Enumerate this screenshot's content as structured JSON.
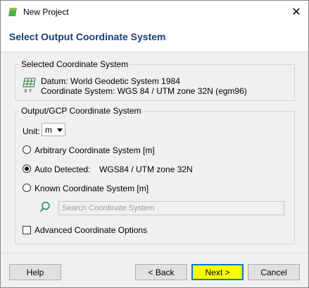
{
  "window": {
    "title": "New Project"
  },
  "header": {
    "title": "Select Output Coordinate System"
  },
  "selected": {
    "group_title": "Selected Coordinate System",
    "datum": "Datum: World Geodetic System 1984",
    "coordinate_system": "Coordinate System: WGS 84 / UTM zone 32N (egm96)",
    "icon": "coordinate-grid-icon",
    "icon_text": "X Y"
  },
  "output": {
    "group_title": "Output/GCP Coordinate System",
    "unit_label": "Unit:",
    "unit_value": "m",
    "options": {
      "arbitrary": "Arbitrary Coordinate System [m]",
      "auto": "Auto Detected:",
      "auto_value": "WGS84 / UTM zone 32N",
      "known": "Known Coordinate System [m]"
    },
    "selected_option": "auto",
    "search_placeholder": "Search Coordinate System",
    "advanced_label": "Advanced Coordinate Options",
    "advanced_checked": false
  },
  "buttons": {
    "help": "Help",
    "back": "< Back",
    "next": "Next >",
    "cancel": "Cancel"
  },
  "colors": {
    "title_blue": "#1a3c7a",
    "highlight_yellow": "#ffff00",
    "focus_blue": "#0078d7",
    "search_green": "#2e8b57"
  }
}
